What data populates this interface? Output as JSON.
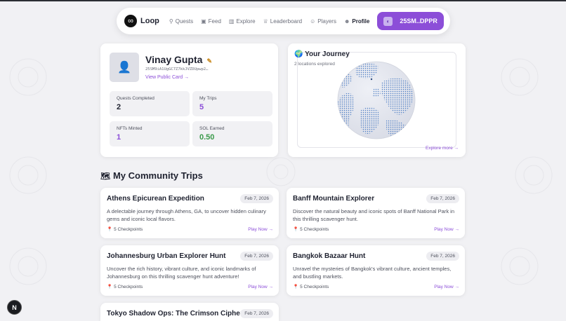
{
  "nav": {
    "logo_text": "Loop",
    "items": [
      {
        "label": "Quests",
        "icon": "map-pin-icon"
      },
      {
        "label": "Feed",
        "icon": "camera-icon"
      },
      {
        "label": "Explore",
        "icon": "bar-chart-icon"
      },
      {
        "label": "Leaderboard",
        "icon": "trophy-icon"
      },
      {
        "label": "Players",
        "icon": "users-icon"
      },
      {
        "label": "Profile",
        "icon": "user-icon"
      }
    ],
    "wallet_label": "25SM..DPPR"
  },
  "profile": {
    "name": "Vinay Gupta",
    "address": "25SM9iA1UgGC7Z7kkJVZDUpwp2…",
    "public_card_link": "View Public Card →",
    "stats": [
      {
        "label": "Quests Completed",
        "value": "2"
      },
      {
        "label": "My Trips",
        "value": "5"
      },
      {
        "label": "NFTs Minted",
        "value": "1"
      },
      {
        "label": "SOL Earned",
        "value": "0.50"
      }
    ]
  },
  "journey": {
    "title": "Your Journey",
    "subtitle": "2 locations explored",
    "explore_more": "Explore more →"
  },
  "trips_section": {
    "title": "My Community Trips",
    "trips": [
      {
        "name": "Athens Epicurean Expedition",
        "date": "Feb 7, 2026",
        "description": "A delectable journey through Athens, GA, to uncover hidden culinary gems and iconic local flavors.",
        "checkpoints": "5 Checkpoints",
        "play": "Play Now →"
      },
      {
        "name": "Banff Mountain Explorer",
        "date": "Feb 7, 2026",
        "description": "Discover the natural beauty and iconic spots of Banff National Park in this thrilling scavenger hunt.",
        "checkpoints": "5 Checkpoints",
        "play": "Play Now →"
      },
      {
        "name": "Johannesburg Urban Explorer Hunt",
        "date": "Feb 7, 2026",
        "description": "Uncover the rich history, vibrant culture, and iconic landmarks of Johannesburg on this thrilling scavenger hunt adventure!",
        "checkpoints": "5 Checkpoints",
        "play": "Play Now →"
      },
      {
        "name": "Bangkok Bazaar Hunt",
        "date": "Feb 7, 2026",
        "description": "Unravel the mysteries of Bangkok's vibrant culture, ancient temples, and bustling markets.",
        "checkpoints": "5 Checkpoints",
        "play": "Play Now →"
      },
      {
        "name": "Tokyo Shadow Ops: The Crimson Cipher",
        "date": "Feb 7, 2026",
        "description": "",
        "checkpoints": "",
        "play": ""
      }
    ]
  },
  "dev_badge": "N",
  "colors": {
    "accent": "#8c4ed8",
    "positive": "#3a9a4a",
    "background": "#f1f1f4"
  }
}
